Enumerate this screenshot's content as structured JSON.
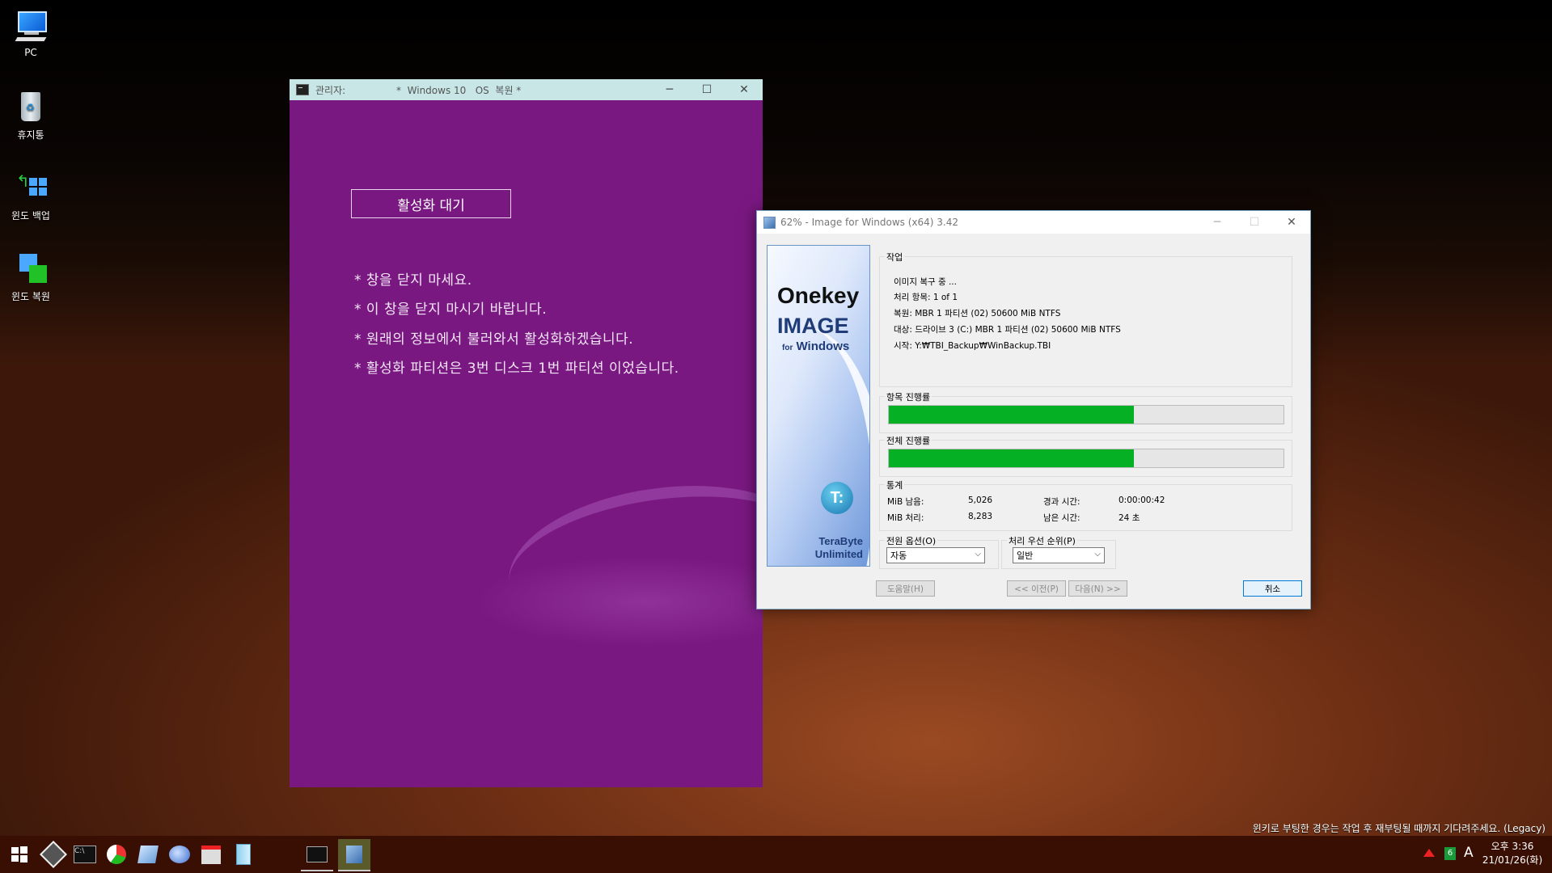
{
  "desktop_icons": [
    {
      "label": "PC",
      "icon": "computer-icon"
    },
    {
      "label": "휴지통",
      "icon": "recycle-bin-icon"
    },
    {
      "label": "윈도 백업",
      "icon": "windows-backup-icon"
    },
    {
      "label": "윈도 복원",
      "icon": "windows-restore-icon"
    }
  ],
  "console": {
    "title_left": "관리자:",
    "title_center": "*  Windows 10   OS  복원 *",
    "button_label": "활성화 대기",
    "lines": [
      "* 창을 닫지 마세요.",
      "* 이 창을 닫지 마시기 바랍니다.",
      "* 원래의 정보에서 불러와서 활성화하겠습니다.",
      "* 활성화 파티션은 3번 디스크 1번 파티션 이었습니다."
    ],
    "bg_color": "#7a1882"
  },
  "ifw": {
    "title": "62% - Image for Windows (x64) 3.42",
    "banner": {
      "line1": "Onekey",
      "line2": "IMAGE",
      "line3_small": "for",
      "line3": "Windows",
      "logo_glyph": "T:",
      "vendor1": "TeraByte",
      "vendor2": "Unlimited"
    },
    "task_label": "작업",
    "task_lines": [
      "이미지 복구 중 ...",
      "처리 항목: 1 of 1",
      "복원: MBR 1 파티션 (02) 50600 MiB NTFS",
      "대상: 드라이브 3 (C:) MBR 1 파티션 (02) 50600 MiB NTFS",
      "시작: Y:₩TBI_Backup₩WinBackup.TBI"
    ],
    "item_progress_label": "항목 진행률",
    "item_progress": 0.62,
    "total_progress_label": "전체 진행률",
    "total_progress": 0.62,
    "progress_color": "#06b025",
    "stats_label": "통계",
    "stats": {
      "remaining_label": "MiB 남음:",
      "remaining_value": "5,026",
      "processed_label": "MiB 처리:",
      "processed_value": "8,283",
      "elapsed_label": "경과 시간:",
      "elapsed_value": "0:00:00:42",
      "left_label": "남은 시간:",
      "left_value": "24 초"
    },
    "power_label": "전원 옵션(O)",
    "power_value": "자동",
    "priority_label": "처리 우선 순위(P)",
    "priority_value": "일반",
    "buttons": {
      "help": "도움말(H)",
      "prev": "<< 이전(P)",
      "next": "다음(N) >>",
      "cancel": "취소"
    }
  },
  "notice": "윈키로 부팅한 경우는 작업 후 재부팅될 때까지 기다려주세요. (Legacy)",
  "taskbar": {
    "items": [
      "start-icon",
      "settings-app-icon",
      "cmd-icon",
      "partition-tool-icon",
      "notepad-icon",
      "disk-tool-icon",
      "network-tool-icon",
      "file-icon"
    ],
    "running": [
      "cmd-running-icon",
      "image-for-windows-running-icon"
    ],
    "tray_badge": "6",
    "ime": "A",
    "time": "오후 3:36",
    "date": "21/01/26(화)"
  }
}
